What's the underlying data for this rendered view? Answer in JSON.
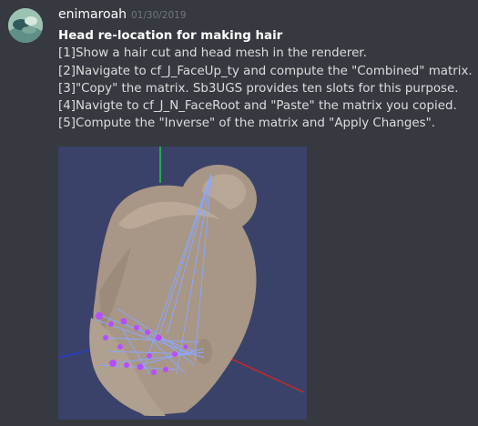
{
  "message": {
    "author": "enimaroah",
    "timestamp": "01/30/2019",
    "lines": [
      "Head re-location for making hair",
      "[1]Show a hair cut and head mesh in the renderer.",
      "[2]Navigate to cf_J_FaceUp_ty and compute the \"Combined\" matrix.",
      "[3]\"Copy\" the matrix. Sb3UGS provides ten slots for this purpose.",
      "[4]Navigte to cf_J_N_FaceRoot and \"Paste\" the matrix you copied.",
      "[5]Compute the \"Inverse\" of the matrix and \"Apply Changes\"."
    ]
  },
  "colors": {
    "background": "#36393f",
    "username": "#ffffff",
    "timestamp": "#72767d",
    "text": "#dcddde",
    "render_bg": "#3b4269",
    "head_mesh": "#a89686",
    "wireframe": "#8aa8ff"
  },
  "icons": {
    "avatar": "user-avatar"
  }
}
